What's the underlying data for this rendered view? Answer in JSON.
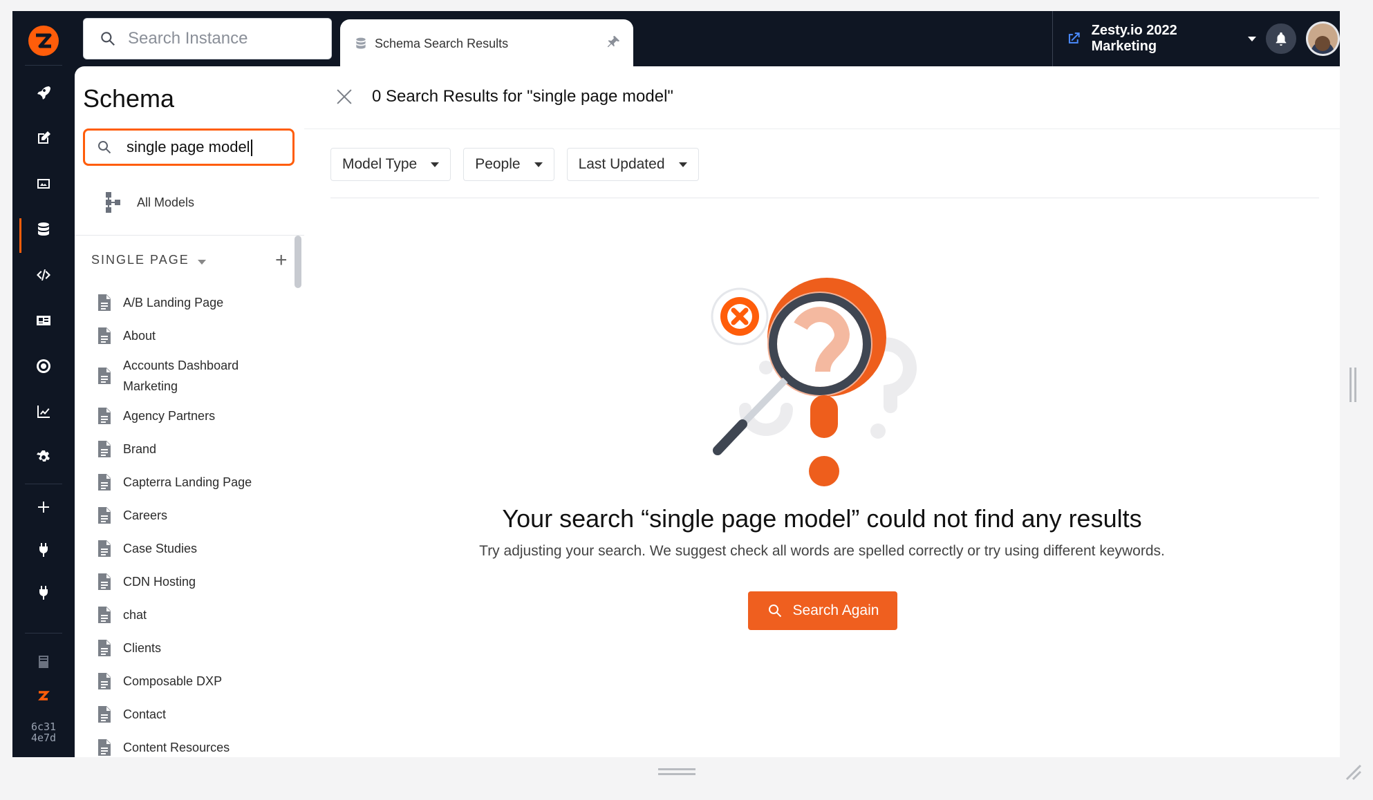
{
  "top": {
    "search_placeholder": "Search Instance",
    "tab_label": "Schema Search Results",
    "instance_name": "Zesty.io 2022 Marketing"
  },
  "rail": {
    "icons": [
      "rocket-icon",
      "edit-icon",
      "image-icon",
      "database-icon",
      "code-icon",
      "id-card-icon",
      "target-icon",
      "chart-icon",
      "gear-icon",
      "plus-icon",
      "plug-icon",
      "plug-icon",
      "book-icon",
      "zesty-logo-icon"
    ],
    "active": "database-icon",
    "build_hash": "6c31\n4e7d"
  },
  "schema": {
    "title": "Schema",
    "search_value": "single page model",
    "all_models_label": "All Models",
    "section_label": "SINGLE PAGE",
    "models": [
      "A/B Landing Page",
      "About",
      "Accounts Dashboard Marketing",
      "Agency Partners",
      "Brand",
      "Capterra Landing Page",
      "Careers",
      "Case Studies",
      "CDN Hosting",
      "chat",
      "Clients",
      "Composable DXP",
      "Contact",
      "Content Resources"
    ]
  },
  "main": {
    "results_title": "0 Search Results for \"single page model\"",
    "filters": [
      "Model Type",
      "People",
      "Last Updated"
    ],
    "empty_title": "Your search “single page model” could not find any results",
    "empty_subtitle": "Try adjusting your search. We suggest check all words are spelled correctly or try using different keywords.",
    "button_label": "Search Again"
  },
  "colors": {
    "accent": "#ff5d0a",
    "button": "#ef5f1f",
    "navy": "#0f1623",
    "link_blue": "#4b8cff"
  }
}
